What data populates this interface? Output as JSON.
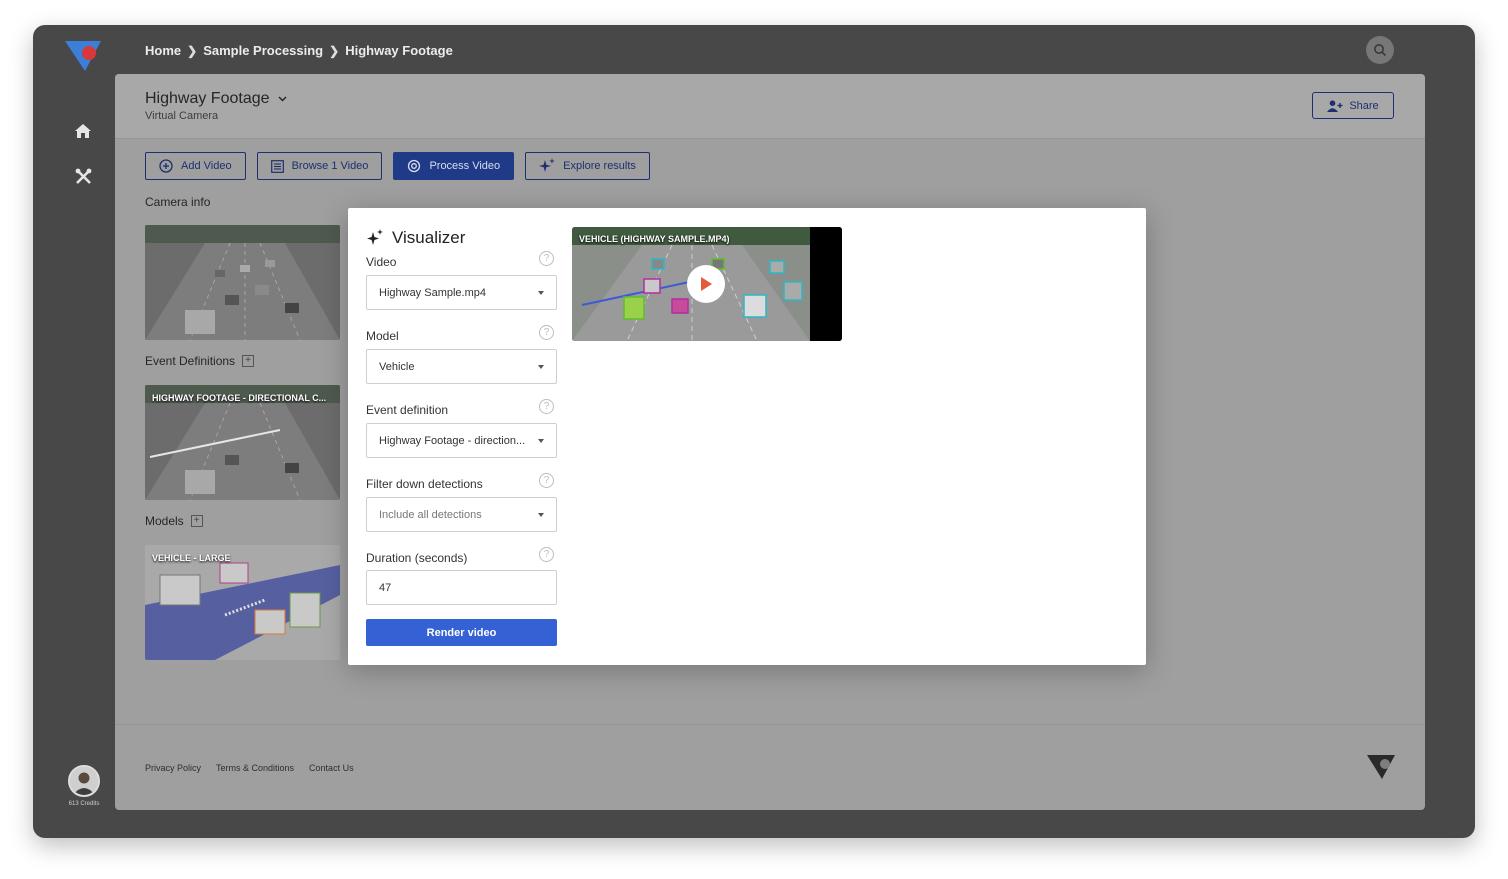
{
  "breadcrumb": [
    "Home",
    "Sample Processing",
    "Highway Footage"
  ],
  "user": {
    "credits": "613 Credits"
  },
  "header": {
    "title": "Highway Footage",
    "subtitle": "Virtual Camera",
    "share_label": "Share"
  },
  "actions": {
    "add_video": "Add Video",
    "browse": "Browse 1 Video",
    "process": "Process Video",
    "explore": "Explore results"
  },
  "sections": {
    "camera_info": "Camera info",
    "event_definitions": "Event Definitions",
    "models": "Models"
  },
  "thumbnails": {
    "event": "HIGHWAY FOOTAGE - DIRECTIONAL C...",
    "model": "VEHICLE - LARGE"
  },
  "footer": {
    "privacy": "Privacy Policy",
    "terms": "Terms & Conditions",
    "contact": "Contact Us"
  },
  "visualizer": {
    "title": "Visualizer",
    "video_label": "Video",
    "video_value": "Highway Sample.mp4",
    "model_label": "Model",
    "model_value": "Vehicle",
    "event_label": "Event definition",
    "event_value": "Highway Footage - direction...",
    "filter_label": "Filter down detections",
    "filter_value": "Include all detections",
    "duration_label": "Duration (seconds)",
    "duration_value": "47",
    "render_label": "Render video",
    "preview_caption": "VEHICLE (HIGHWAY SAMPLE.MP4)"
  },
  "colors": {
    "primary": "#3461d4",
    "dark_blue": "#1f3a86",
    "frame": "#484848"
  }
}
